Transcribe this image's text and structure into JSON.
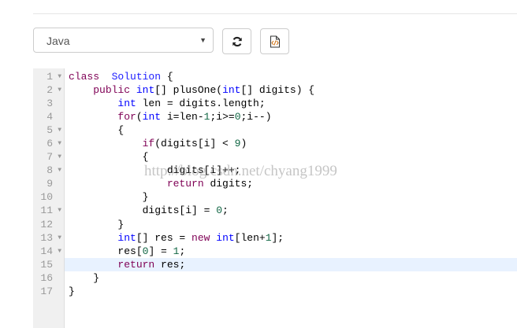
{
  "language_select": {
    "value": "Java"
  },
  "buttons": {
    "reset": "refresh-icon",
    "file": "code-file-icon"
  },
  "watermark": "http://blog.csdn.net/chyang1999",
  "active_line": 15,
  "lines": [
    {
      "n": "1",
      "fold": true,
      "t": [
        [
          "kw",
          "class"
        ],
        [
          "",
          "  "
        ],
        [
          "cls",
          "Solution"
        ],
        [
          "",
          " {"
        ]
      ]
    },
    {
      "n": "2",
      "fold": true,
      "t": [
        [
          "",
          "    "
        ],
        [
          "kw",
          "public"
        ],
        [
          "",
          " "
        ],
        [
          "ty",
          "int"
        ],
        [
          "",
          "[] plusOne("
        ],
        [
          "ty",
          "int"
        ],
        [
          "",
          "[] digits) {"
        ]
      ]
    },
    {
      "n": "3",
      "fold": false,
      "t": [
        [
          "",
          "        "
        ],
        [
          "ty",
          "int"
        ],
        [
          "",
          " len = digits.length;"
        ]
      ]
    },
    {
      "n": "4",
      "fold": false,
      "t": [
        [
          "",
          "        "
        ],
        [
          "kw",
          "for"
        ],
        [
          "",
          "("
        ],
        [
          "ty",
          "int"
        ],
        [
          "",
          " i=len-"
        ],
        [
          "num",
          "1"
        ],
        [
          "",
          ";i>="
        ],
        [
          "num",
          "0"
        ],
        [
          "",
          ";i--)"
        ]
      ]
    },
    {
      "n": "5",
      "fold": true,
      "t": [
        [
          "",
          "        {"
        ]
      ]
    },
    {
      "n": "6",
      "fold": true,
      "t": [
        [
          "",
          "            "
        ],
        [
          "kw",
          "if"
        ],
        [
          "",
          "(digits[i] < "
        ],
        [
          "num",
          "9"
        ],
        [
          "",
          ")"
        ]
      ]
    },
    {
      "n": "7",
      "fold": true,
      "t": [
        [
          "",
          "            {"
        ]
      ]
    },
    {
      "n": "8",
      "fold": true,
      "t": [
        [
          "",
          "                digits[i]++;"
        ]
      ]
    },
    {
      "n": "9",
      "fold": false,
      "t": [
        [
          "",
          "                "
        ],
        [
          "kw",
          "return"
        ],
        [
          "",
          " digits;"
        ]
      ]
    },
    {
      "n": "10",
      "fold": false,
      "t": [
        [
          "",
          "            }"
        ]
      ]
    },
    {
      "n": "11",
      "fold": true,
      "t": [
        [
          "",
          "            digits[i] = "
        ],
        [
          "num",
          "0"
        ],
        [
          "",
          ";"
        ]
      ]
    },
    {
      "n": "12",
      "fold": false,
      "t": [
        [
          "",
          "        }"
        ]
      ]
    },
    {
      "n": "13",
      "fold": true,
      "t": [
        [
          "",
          "        "
        ],
        [
          "ty",
          "int"
        ],
        [
          "",
          "[] res = "
        ],
        [
          "kw",
          "new"
        ],
        [
          "",
          " "
        ],
        [
          "ty",
          "int"
        ],
        [
          "",
          "[len+"
        ],
        [
          "num",
          "1"
        ],
        [
          "",
          "];"
        ]
      ]
    },
    {
      "n": "14",
      "fold": true,
      "t": [
        [
          "",
          "        res["
        ],
        [
          "num",
          "0"
        ],
        [
          "",
          "] = "
        ],
        [
          "num",
          "1"
        ],
        [
          "",
          ";"
        ]
      ]
    },
    {
      "n": "15",
      "fold": false,
      "t": [
        [
          "",
          "        "
        ],
        [
          "kw",
          "return"
        ],
        [
          "",
          " res;"
        ]
      ]
    },
    {
      "n": "16",
      "fold": false,
      "t": [
        [
          "",
          "    }"
        ]
      ]
    },
    {
      "n": "17",
      "fold": false,
      "t": [
        [
          "",
          "}"
        ]
      ]
    }
  ]
}
